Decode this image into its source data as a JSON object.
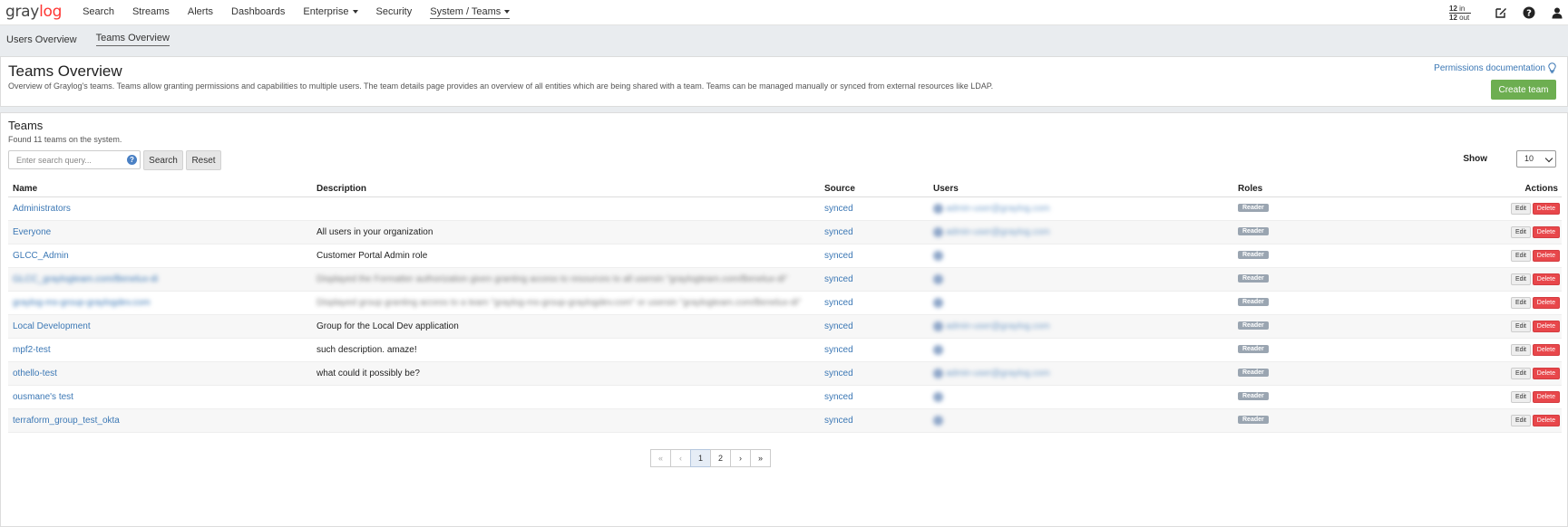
{
  "nav": {
    "logo_gray": "gray",
    "logo_log": "log",
    "items": [
      {
        "label": "Search"
      },
      {
        "label": "Streams"
      },
      {
        "label": "Alerts"
      },
      {
        "label": "Dashboards"
      },
      {
        "label": "Enterprise",
        "dropdown": true
      },
      {
        "label": "Security"
      },
      {
        "label": "System / Teams",
        "dropdown": true,
        "active": true
      }
    ],
    "throughput_in": "12",
    "throughput_in_label": "in",
    "throughput_out": "12",
    "throughput_out_label": "out"
  },
  "subnav": {
    "users_overview": "Users Overview",
    "teams_overview": "Teams Overview"
  },
  "header": {
    "title": "Teams Overview",
    "description": "Overview of Graylog's teams. Teams allow granting permissions and capabilities to multiple users. The team details page provides an overview of all entities which are being shared with a team. Teams can be managed manually or synced from external resources like LDAP.",
    "permissions_doc": "Permissions documentation",
    "create_team": "Create team"
  },
  "teams": {
    "title": "Teams",
    "count_text": "Found 11 teams on the system.",
    "search_placeholder": "Enter search query...",
    "search_button": "Search",
    "reset_button": "Reset",
    "show_label": "Show",
    "show_value": "10",
    "columns": {
      "name": "Name",
      "description": "Description",
      "source": "Source",
      "users": "Users",
      "roles": "Roles",
      "actions": "Actions"
    },
    "edit_label": "Edit",
    "delete_label": "Delete",
    "rows": [
      {
        "name": "Administrators",
        "description": "",
        "source": "synced",
        "users": "admin-user@graylog.com",
        "role": "Reader",
        "blur_name": false,
        "blur_desc": false,
        "avatar_only": false
      },
      {
        "name": "Everyone",
        "description": "All users in your organization",
        "source": "synced",
        "users": "admin-user@graylog.com",
        "role": "Reader",
        "blur_name": false,
        "blur_desc": false,
        "avatar_only": false
      },
      {
        "name": "GLCC_Admin",
        "description": "Customer Portal Admin role",
        "source": "synced",
        "users": "",
        "role": "Reader",
        "blur_name": false,
        "blur_desc": false,
        "avatar_only": true
      },
      {
        "name": "GLCC_graylogteam.com/Benelux-di",
        "description": "Displayed the Formatter authorization given granting access to resources to all usersin \"graylogteam.com/Benelux-di\"",
        "source": "synced",
        "users": "",
        "role": "Reader",
        "blur_name": true,
        "blur_desc": true,
        "avatar_only": true
      },
      {
        "name": "graylog-ms-group-graylogdev.com",
        "description": "Displayed group granting access to a team \"graylog-ms-group-graylogdev.com\" or usersin \"graylogteam.com/Benelux-di\"",
        "source": "synced",
        "users": "",
        "role": "Reader",
        "blur_name": true,
        "blur_desc": true,
        "avatar_only": true
      },
      {
        "name": "Local Development",
        "description": "Group for the Local Dev application",
        "source": "synced",
        "users": "admin-user@graylog.com",
        "role": "Reader",
        "blur_name": false,
        "blur_desc": false,
        "avatar_only": false
      },
      {
        "name": "mpf2-test",
        "description": "such description. amaze!",
        "source": "synced",
        "users": "",
        "role": "Reader",
        "blur_name": false,
        "blur_desc": false,
        "avatar_only": true
      },
      {
        "name": "othello-test",
        "description": "what could it possibly be?",
        "source": "synced",
        "users": "admin-user@graylog.com",
        "role": "Reader",
        "blur_name": false,
        "blur_desc": false,
        "avatar_only": false
      },
      {
        "name": "ousmane's test",
        "description": "",
        "source": "synced",
        "users": "",
        "role": "Reader",
        "blur_name": false,
        "blur_desc": false,
        "avatar_only": true
      },
      {
        "name": "terraform_group_test_okta",
        "description": "",
        "source": "synced",
        "users": "",
        "role": "Reader",
        "blur_name": false,
        "blur_desc": false,
        "avatar_only": true
      }
    ]
  },
  "pagination": {
    "pages": [
      "1",
      "2"
    ],
    "current": "1",
    "first": "«",
    "prev": "‹",
    "next": "›",
    "last": "»"
  },
  "colors": {
    "accent_link": "#3c78b5",
    "create_button": "#6dae51",
    "delete_button": "#e8474b",
    "role_badge": "#9aa5b1",
    "logo_accent": "#ff3633"
  }
}
